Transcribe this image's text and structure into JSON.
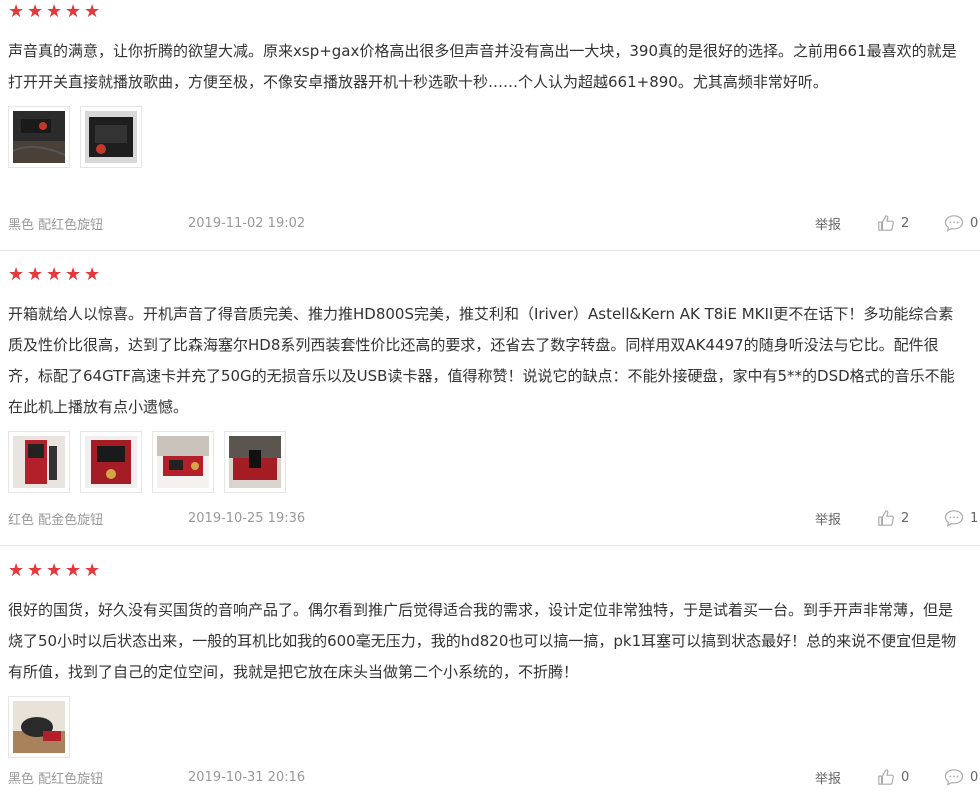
{
  "reviews": [
    {
      "stars": 5,
      "content": "声音真的满意，让你折腾的欲望大减。原来xsp+gax价格高出很多但声音并没有高出一大块，390真的是很好的选择。之前用661最喜欢的就是打开开关直接就播放歌曲，方便至极，不像安卓播放器开机十秒选歌十秒……个人认为超越661+890。尤其高频非常好听。",
      "images": [
        "product-photo",
        "product-photo"
      ],
      "spec": "黑色 配红色旋钮",
      "date": "2019-11-02 19:02",
      "report": "举报",
      "likes": "2",
      "comments": "0"
    },
    {
      "stars": 5,
      "content": "开箱就给人以惊喜。开机声音了得音质完美、推力推HD800S完美，推艾利和（Iriver）Astell&Kern AK T8iE MKII更不在话下！多功能综合素质及性价比很高，达到了比森海塞尔HD8系列西装套性价比还高的要求，还省去了数字转盘。同样用双AK4497的随身听没法与它比。配件很齐，标配了64GTF高速卡并充了50G的无损音乐以及USB读卡器，值得称赞！说说它的缺点：不能外接硬盘，家中有5**的DSD格式的音乐不能在此机上播放有点小遗憾。",
      "images": [
        "product-photo",
        "product-photo",
        "product-photo",
        "product-photo"
      ],
      "spec": "红色 配金色旋钮",
      "date": "2019-10-25 19:36",
      "report": "举报",
      "likes": "2",
      "comments": "1"
    },
    {
      "stars": 5,
      "content": "很好的国货，好久没有买国货的音响产品了。偶尔看到推广后觉得适合我的需求，设计定位非常独特，于是试着买一台。到手开声非常薄，但是烧了50小时以后状态出来，一般的耳机比如我的600毫无压力，我的hd820也可以搞一搞，pk1耳塞可以搞到状态最好！总的来说不便宜但是物有所值，找到了自己的定位空间，我就是把它放在床头当做第二个小系统的，不折腾！",
      "images": [
        "product-photo"
      ],
      "spec": "黑色 配红色旋钮",
      "date": "2019-10-31 20:16",
      "report": "举报",
      "likes": "0",
      "comments": "0"
    }
  ],
  "colors": {
    "star": "#e4393c",
    "meta": "#999999",
    "divider": "#e6e6e6"
  },
  "icons": {
    "star": "star-icon",
    "like": "thumbs-up-icon",
    "comment": "comment-bubble-icon"
  }
}
